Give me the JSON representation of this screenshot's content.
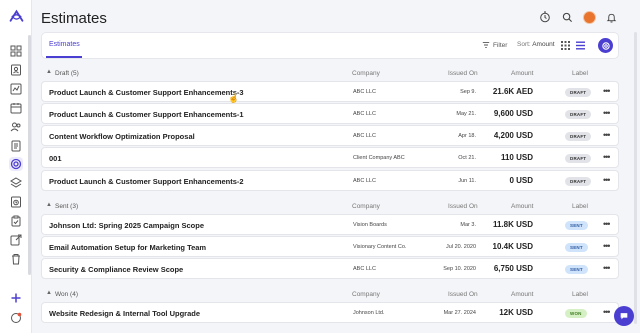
{
  "header": {
    "title": "Estimates",
    "icons": [
      "timer-icon",
      "search-icon",
      "avatar",
      "bell-icon"
    ]
  },
  "toolbar": {
    "tab_label": "Estimates",
    "filter_label": "Filter",
    "sort_prefix": "Sort:",
    "sort_value": "Amount"
  },
  "columns": {
    "company": "Company",
    "issued": "Issued On",
    "amount": "Amount",
    "label": "Label"
  },
  "sections": [
    {
      "title": "Draft (5)",
      "rows": [
        {
          "name": "Product Launch & Customer Support Enhancements-3",
          "company": "ABC LLC",
          "issued": "Sep 9.",
          "amount": "21.6K AED",
          "label": "DRAFT"
        },
        {
          "name": "Product Launch & Customer Support Enhancements-1",
          "company": "ABC LLC",
          "issued": "May 21.",
          "amount": "9,600 USD",
          "label": "DRAFT"
        },
        {
          "name": "Content Workflow Optimization Proposal",
          "company": "ABC LLC",
          "issued": "Apr 18.",
          "amount": "4,200 USD",
          "label": "DRAFT"
        },
        {
          "name": "001",
          "company": "Client Company ABC",
          "issued": "Oct 21.",
          "amount": "110 USD",
          "label": "DRAFT"
        },
        {
          "name": "Product Launch & Customer Support Enhancements-2",
          "company": "ABC LLC",
          "issued": "Jun 11.",
          "amount": "0 USD",
          "label": "DRAFT"
        }
      ]
    },
    {
      "title": "Sent (3)",
      "rows": [
        {
          "name": "Johnson Ltd: Spring 2025 Campaign Scope",
          "company": "Vision Boards",
          "issued": "Mar 3.",
          "amount": "11.8K USD",
          "label": "SENT"
        },
        {
          "name": "Email Automation Setup for Marketing Team",
          "company": "Visionary Content Co.",
          "issued": "Jul 20. 2020",
          "amount": "10.4K USD",
          "label": "SENT"
        },
        {
          "name": "Security & Compliance Review Scope",
          "company": "ABC LLC",
          "issued": "Sep 10. 2020",
          "amount": "6,750 USD",
          "label": "SENT"
        }
      ]
    },
    {
      "title": "Won (4)",
      "rows": [
        {
          "name": "Website Redesign & Internal Tool Upgrade",
          "company": "Johnson Ltd.",
          "issued": "Mar 27. 2024",
          "amount": "12K USD",
          "label": "WON"
        }
      ]
    }
  ],
  "more_glyph": "•••",
  "colors": {
    "accent": "#4b3fd1",
    "draft_badge": "#e2e3e8",
    "sent_badge": "#cfe3fb",
    "won_badge": "#d6f0c6"
  }
}
